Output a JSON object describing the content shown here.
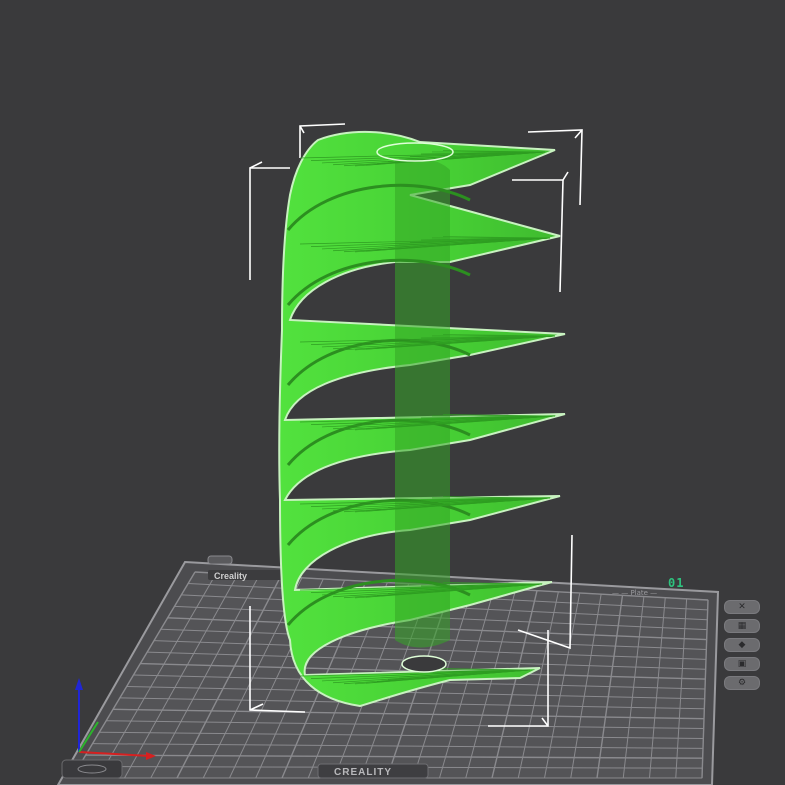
{
  "plate": {
    "number": "01",
    "brand_front": "CREALITY",
    "brand_top_left": "Creality",
    "label_top_right": "— — Plate —"
  },
  "side_tools": [
    {
      "icon": "close-x-icon",
      "glyph": "✕"
    },
    {
      "icon": "auto-arrange-icon",
      "glyph": "▦"
    },
    {
      "icon": "orient-icon",
      "glyph": "◆"
    },
    {
      "icon": "lock-icon",
      "glyph": "▣"
    },
    {
      "icon": "settings-gear-icon",
      "glyph": "⚙"
    }
  ],
  "colors": {
    "background": "#3a3a3c",
    "model": "#4cd93a",
    "bed": "#555557",
    "grid": "#8a8a8e",
    "bounding_box": "#ffffff",
    "plate_number": "#2ec27e",
    "axis_x": "#d62020",
    "axis_y": "#2bb52b",
    "axis_z": "#2026d6"
  }
}
